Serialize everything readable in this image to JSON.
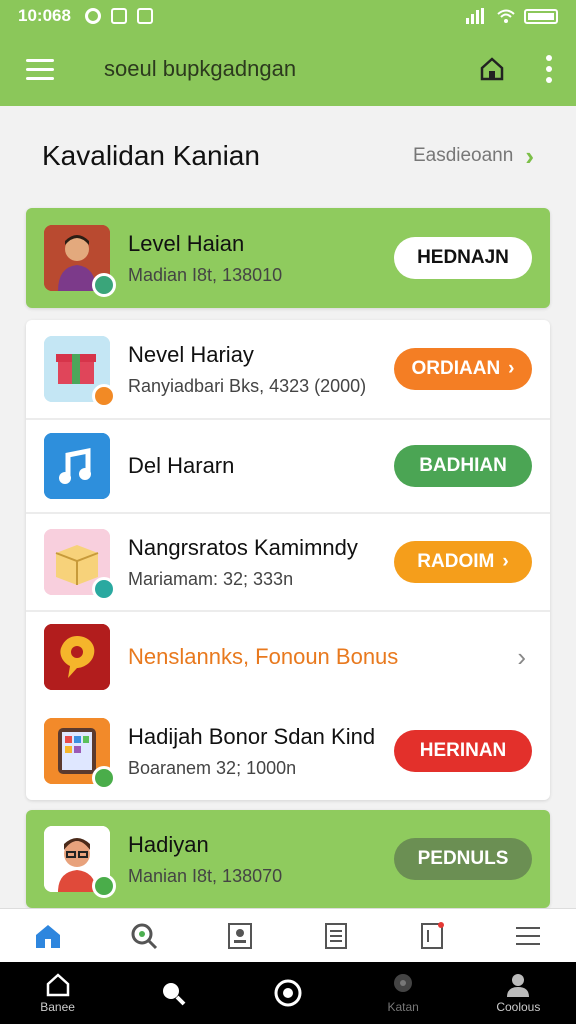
{
  "status_bar": {
    "time": "10:068"
  },
  "app_bar": {
    "title": "soeul bupkgadngan"
  },
  "section": {
    "title": "Kavalidan Kanian",
    "see_all": "Easdieoann"
  },
  "cards": [
    {
      "variant": "green",
      "rows": [
        {
          "title": "Level Haian",
          "subtitle": "Madian I8t, 138010",
          "button": "HEDNAJN",
          "button_style": "white",
          "icon": "avatar-man-icon"
        }
      ]
    },
    {
      "variant": "white",
      "rows": [
        {
          "title": "Nevel Hariay",
          "subtitle": "Ranyiadbari Bks, 4323 (2000)",
          "button": "ORDIAAN",
          "button_style": "orange",
          "icon": "gift-box-icon"
        },
        {
          "title": "Del Hararn",
          "subtitle": "",
          "button": "BADHIAN",
          "button_style": "green",
          "icon": "music-note-icon"
        },
        {
          "title": "Nangrsratos Kamimndy",
          "subtitle": "Mariamam: 32; 333n",
          "button": "RADOIM",
          "button_style": "amber",
          "icon": "package-box-icon"
        },
        {
          "title": "Nenslannks, Fonoun Bonus",
          "subtitle": "",
          "button": "",
          "button_style": "chevron",
          "icon": "chat-bubble-icon"
        },
        {
          "title": "Hadijah Bonor Sdan Kind",
          "subtitle": "Boaranem 32; 1000n",
          "button": "HERINAN",
          "button_style": "red",
          "icon": "tablet-apps-icon"
        }
      ]
    },
    {
      "variant": "green",
      "rows": [
        {
          "title": "Hadiyan",
          "subtitle": "Manian I8t, 138070",
          "button": "PEDNULS",
          "button_style": "olive",
          "icon": "avatar-glasses-icon"
        }
      ]
    }
  ],
  "nav": [
    {
      "label": "Banee",
      "icon": "home-icon"
    },
    {
      "label": "",
      "icon": "search-icon"
    },
    {
      "label": "",
      "icon": "circle-icon"
    },
    {
      "label": "Katan",
      "icon": "pin-icon"
    },
    {
      "label": "Coolous",
      "icon": "profile-icon"
    }
  ],
  "colors": {
    "brand_green": "#8bc75a",
    "orange": "#f47e24",
    "green_button": "#4ba554",
    "amber": "#f59e1b",
    "red": "#e3302b"
  }
}
